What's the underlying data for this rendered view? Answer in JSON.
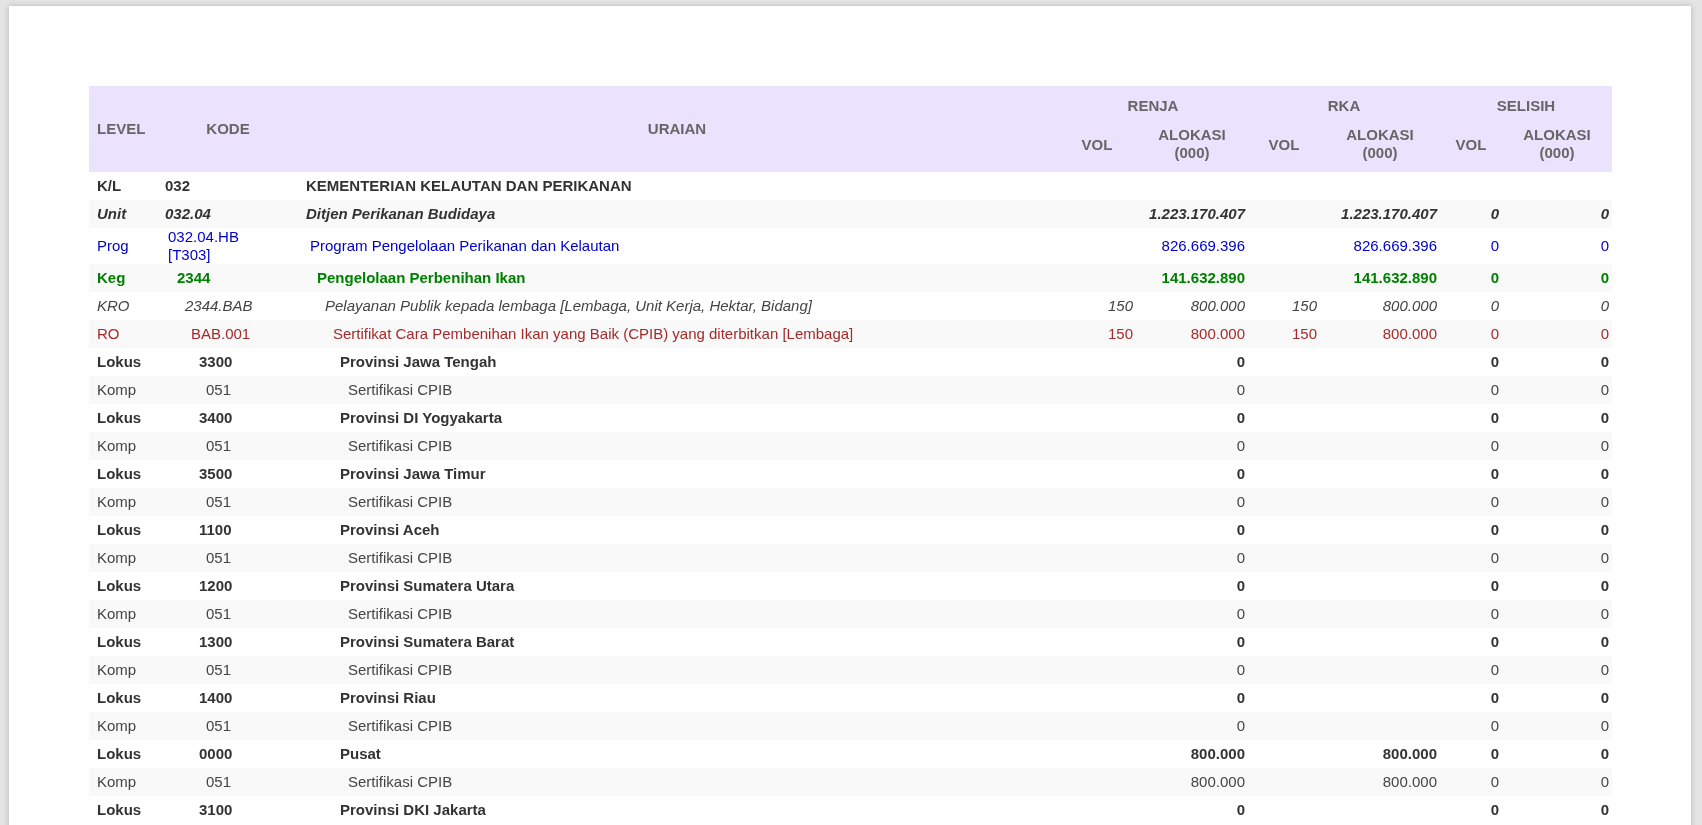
{
  "table": {
    "columns": {
      "level": "LEVEL",
      "kode": "KODE",
      "uraian": "URAIAN",
      "groups": [
        {
          "label": "RENJA",
          "vol": "VOL",
          "alokasi": "ALOKASI (000)"
        },
        {
          "label": "RKA",
          "vol": "VOL",
          "alokasi": "ALOKASI (000)"
        },
        {
          "label": "SELISIH",
          "vol": "VOL",
          "alokasi": "ALOKASI (000)"
        }
      ]
    },
    "rows": [
      {
        "kind": "kl",
        "level": "K/L",
        "kode": "032",
        "uraian": "KEMENTERIAN KELAUTAN DAN PERIKANAN"
      },
      {
        "kind": "unit",
        "level": "Unit",
        "kode": "032.04",
        "uraian": "Ditjen Perikanan Budidaya",
        "renja_alokasi": "1.223.170.407",
        "rka_alokasi": "1.223.170.407",
        "selisih_vol": "0",
        "selisih_alokasi": "0"
      },
      {
        "kind": "prog",
        "level": "Prog",
        "kode": "032.04.HB [T303]",
        "uraian": "Program Pengelolaan Perikanan dan Kelautan",
        "renja_alokasi": "826.669.396",
        "rka_alokasi": "826.669.396",
        "selisih_vol": "0",
        "selisih_alokasi": "0"
      },
      {
        "kind": "keg",
        "level": "Keg",
        "kode": "2344",
        "uraian": "Pengelolaan Perbenihan Ikan",
        "renja_alokasi": "141.632.890",
        "rka_alokasi": "141.632.890",
        "selisih_vol": "0",
        "selisih_alokasi": "0"
      },
      {
        "kind": "kro",
        "level": "KRO",
        "kode": "2344.BAB",
        "uraian": "Pelayanan Publik kepada lembaga [Lembaga, Unit Kerja, Hektar, Bidang]",
        "renja_vol": "150",
        "renja_alokasi": "800.000",
        "rka_vol": "150",
        "rka_alokasi": "800.000",
        "selisih_vol": "0",
        "selisih_alokasi": "0"
      },
      {
        "kind": "ro",
        "level": "RO",
        "kode": "BAB.001",
        "uraian": "Sertifikat Cara Pembenihan Ikan yang Baik (CPIB) yang diterbitkan [Lembaga]",
        "renja_vol": "150",
        "renja_alokasi": "800.000",
        "rka_vol": "150",
        "rka_alokasi": "800.000",
        "selisih_vol": "0",
        "selisih_alokasi": "0"
      },
      {
        "kind": "lokus",
        "level": "Lokus",
        "kode": "3300",
        "uraian": "Provinsi Jawa Tengah",
        "renja_alokasi": "0",
        "selisih_vol": "0",
        "selisih_alokasi": "0"
      },
      {
        "kind": "komp",
        "level": "Komp",
        "kode": "051",
        "uraian": "Sertifikasi CPIB",
        "renja_alokasi": "0",
        "selisih_vol": "0",
        "selisih_alokasi": "0"
      },
      {
        "kind": "lokus",
        "level": "Lokus",
        "kode": "3400",
        "uraian": "Provinsi DI Yogyakarta",
        "renja_alokasi": "0",
        "selisih_vol": "0",
        "selisih_alokasi": "0"
      },
      {
        "kind": "komp",
        "level": "Komp",
        "kode": "051",
        "uraian": "Sertifikasi CPIB",
        "renja_alokasi": "0",
        "selisih_vol": "0",
        "selisih_alokasi": "0"
      },
      {
        "kind": "lokus",
        "level": "Lokus",
        "kode": "3500",
        "uraian": "Provinsi Jawa Timur",
        "renja_alokasi": "0",
        "selisih_vol": "0",
        "selisih_alokasi": "0"
      },
      {
        "kind": "komp",
        "level": "Komp",
        "kode": "051",
        "uraian": "Sertifikasi CPIB",
        "renja_alokasi": "0",
        "selisih_vol": "0",
        "selisih_alokasi": "0"
      },
      {
        "kind": "lokus",
        "level": "Lokus",
        "kode": "1100",
        "uraian": "Provinsi Aceh",
        "renja_alokasi": "0",
        "selisih_vol": "0",
        "selisih_alokasi": "0"
      },
      {
        "kind": "komp",
        "level": "Komp",
        "kode": "051",
        "uraian": "Sertifikasi CPIB",
        "renja_alokasi": "0",
        "selisih_vol": "0",
        "selisih_alokasi": "0"
      },
      {
        "kind": "lokus",
        "level": "Lokus",
        "kode": "1200",
        "uraian": "Provinsi Sumatera Utara",
        "renja_alokasi": "0",
        "selisih_vol": "0",
        "selisih_alokasi": "0"
      },
      {
        "kind": "komp",
        "level": "Komp",
        "kode": "051",
        "uraian": "Sertifikasi CPIB",
        "renja_alokasi": "0",
        "selisih_vol": "0",
        "selisih_alokasi": "0"
      },
      {
        "kind": "lokus",
        "level": "Lokus",
        "kode": "1300",
        "uraian": "Provinsi Sumatera Barat",
        "renja_alokasi": "0",
        "selisih_vol": "0",
        "selisih_alokasi": "0"
      },
      {
        "kind": "komp",
        "level": "Komp",
        "kode": "051",
        "uraian": "Sertifikasi CPIB",
        "renja_alokasi": "0",
        "selisih_vol": "0",
        "selisih_alokasi": "0"
      },
      {
        "kind": "lokus",
        "level": "Lokus",
        "kode": "1400",
        "uraian": "Provinsi Riau",
        "renja_alokasi": "0",
        "selisih_vol": "0",
        "selisih_alokasi": "0"
      },
      {
        "kind": "komp",
        "level": "Komp",
        "kode": "051",
        "uraian": "Sertifikasi CPIB",
        "renja_alokasi": "0",
        "selisih_vol": "0",
        "selisih_alokasi": "0"
      },
      {
        "kind": "lokus",
        "level": "Lokus",
        "kode": "0000",
        "uraian": "Pusat",
        "renja_alokasi": "800.000",
        "rka_alokasi": "800.000",
        "selisih_vol": "0",
        "selisih_alokasi": "0"
      },
      {
        "kind": "komp",
        "level": "Komp",
        "kode": "051",
        "uraian": "Sertifikasi CPIB",
        "renja_alokasi": "800.000",
        "rka_alokasi": "800.000",
        "selisih_vol": "0",
        "selisih_alokasi": "0"
      },
      {
        "kind": "lokus",
        "level": "Lokus",
        "kode": "3100",
        "uraian": "Provinsi DKI Jakarta",
        "renja_alokasi": "0",
        "selisih_vol": "0",
        "selisih_alokasi": "0"
      }
    ]
  }
}
